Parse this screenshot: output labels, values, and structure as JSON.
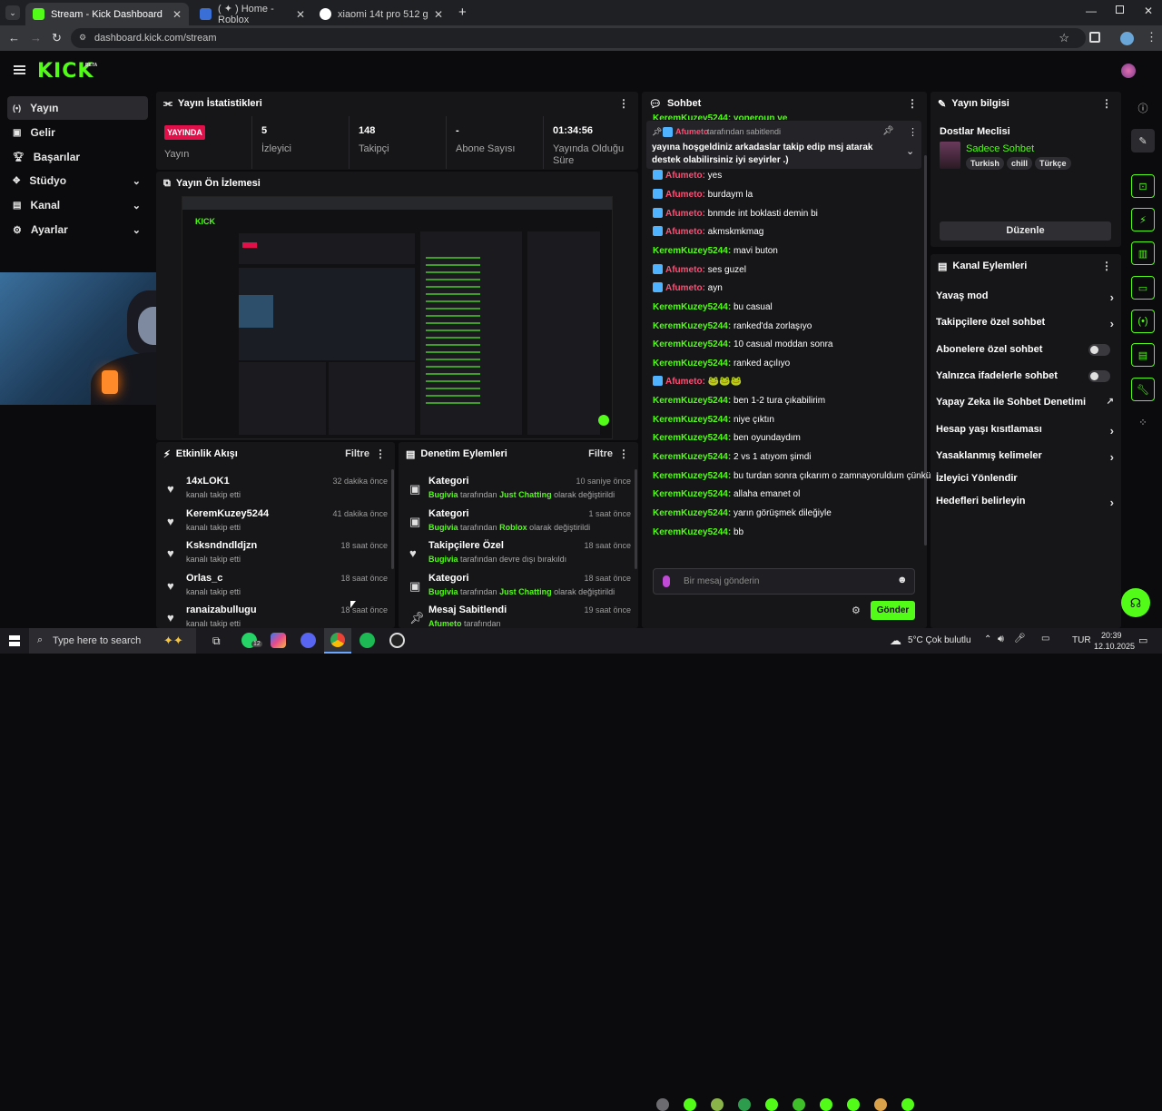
{
  "browser": {
    "tabs": [
      {
        "label": "Stream - Kick Dashboard"
      },
      {
        "label": "( ✦ ) Home - Roblox"
      },
      {
        "label": "xiaomi 14t pro 512 gb - Google"
      }
    ],
    "url": "dashboard.kick.com/stream"
  },
  "kick": {
    "logo": "KICK",
    "beta": "BETA"
  },
  "sidebar": {
    "items": [
      {
        "label": "Yayın"
      },
      {
        "label": "Gelir"
      },
      {
        "label": "Başarılar"
      },
      {
        "label": "Stüdyo"
      },
      {
        "label": "Kanal"
      },
      {
        "label": "Ayarlar"
      }
    ]
  },
  "stats": {
    "title": "Yayın İstatistikleri",
    "live_badge": "YAYINDA",
    "live_label": "Yayın",
    "items": [
      {
        "value": "5",
        "label": "İzleyici"
      },
      {
        "value": "148",
        "label": "Takipçi"
      },
      {
        "value": "-",
        "label": "Abone Sayısı"
      },
      {
        "value": "01:34:56",
        "label": "Yayında Olduğu Süre"
      }
    ]
  },
  "preview": {
    "title": "Yayın Ön İzlemesi"
  },
  "activity": {
    "title": "Etkinlik Akışı",
    "filter": "Filtre",
    "rows": [
      {
        "name": "14xLOK1",
        "sub": "kanalı takip etti",
        "time": "32 dakika önce"
      },
      {
        "name": "KeremKuzey5244",
        "sub": "kanalı takip etti",
        "time": "41 dakika önce"
      },
      {
        "name": "Ksksndndldjzn",
        "sub": "kanalı takip etti",
        "time": "18 saat önce"
      },
      {
        "name": "Orlas_c",
        "sub": "kanalı takip etti",
        "time": "18 saat önce"
      },
      {
        "name": "ranaizabullugu",
        "sub": "kanalı takip etti",
        "time": "18 saat önce"
      }
    ]
  },
  "moderation": {
    "title": "Denetim Eylemleri",
    "filter": "Filtre",
    "rows": [
      {
        "title": "Kategori",
        "user": "Bugivia",
        "mid": "tarafından",
        "hl": "Just Chatting",
        "end": "olarak değiştirildi",
        "time": "10 saniye önce"
      },
      {
        "title": "Kategori",
        "user": "Bugivia",
        "mid": "tarafından",
        "hl": "Roblox",
        "end": "olarak değiştirildi",
        "time": "1 saat önce"
      },
      {
        "title": "Takipçilere Özel",
        "user": "Bugivia",
        "mid": "tarafından devre dışı bırakıldı",
        "hl": "",
        "end": "",
        "time": "18 saat önce"
      },
      {
        "title": "Kategori",
        "user": "Bugivia",
        "mid": "tarafından",
        "hl": "Just Chatting",
        "end": "olarak değiştirildi",
        "time": "18 saat önce"
      },
      {
        "title": "Mesaj Sabitlendi",
        "user": "Afumeto",
        "mid": "tarafından",
        "hl": "",
        "end": "",
        "time": "19 saat önce"
      }
    ]
  },
  "chat": {
    "title": "Sohbet",
    "top_partial": "KeremKuzey5244: yoneroun ve",
    "pinned_by": "Afumeto",
    "pinned_label": "tarafından sabitlendi",
    "pinned_text": "yayına hoşgeldiniz arkadaslar takip edip msj atarak destek olabilirsiniz iyi seyirler .)",
    "messages": [
      {
        "user": "Afumeto",
        "text": "yes",
        "type": "p"
      },
      {
        "user": "Afumeto",
        "text": "burdaym la",
        "type": "p"
      },
      {
        "user": "Afumeto",
        "text": "bnmde int boklasti demin bi",
        "type": "p"
      },
      {
        "user": "Afumeto",
        "text": "akmskmkmag",
        "type": "p"
      },
      {
        "user": "KeremKuzey5244",
        "text": "mavi buton",
        "type": "g"
      },
      {
        "user": "Afumeto",
        "text": "ses guzel",
        "type": "p"
      },
      {
        "user": "Afumeto",
        "text": "ayn",
        "type": "p"
      },
      {
        "user": "KeremKuzey5244",
        "text": "bu casual",
        "type": "g"
      },
      {
        "user": "KeremKuzey5244",
        "text": "ranked'da zorlaşıyo",
        "type": "g"
      },
      {
        "user": "KeremKuzey5244",
        "text": "10 casual moddan sonra",
        "type": "g"
      },
      {
        "user": "KeremKuzey5244",
        "text": "ranked açılıyo",
        "type": "g"
      },
      {
        "user": "Afumeto",
        "text": "🐸🐸🐸",
        "type": "p"
      },
      {
        "user": "KeremKuzey5244",
        "text": "ben 1-2 tura çıkabilirim",
        "type": "g"
      },
      {
        "user": "KeremKuzey5244",
        "text": "niye çıktın",
        "type": "g"
      },
      {
        "user": "KeremKuzey5244",
        "text": "ben oyundaydım",
        "type": "g"
      },
      {
        "user": "KeremKuzey5244",
        "text": "2 vs 1 atıyom şimdi",
        "type": "g"
      },
      {
        "user": "KeremKuzey5244",
        "text": "bu turdan sonra çıkarım o zamnayoruldum çünkü",
        "type": "g"
      },
      {
        "user": "KeremKuzey5244",
        "text": "allaha emanet ol",
        "type": "g"
      },
      {
        "user": "KeremKuzey5244",
        "text": "yarın görüşmek dileğiyle",
        "type": "g"
      },
      {
        "user": "KeremKuzey5244",
        "text": "bb",
        "type": "g"
      }
    ],
    "input_placeholder": "Bir mesaj gönderin",
    "send": "Gönder"
  },
  "info": {
    "title": "Yayın bilgisi",
    "stream_title": "Dostlar Meclisi",
    "mode": "Sadece Sohbet",
    "tags": [
      "Turkish",
      "chill",
      "Türkçe"
    ],
    "edit": "Düzenle"
  },
  "channel_actions": {
    "title": "Kanal Eylemleri",
    "items": [
      {
        "label": "Yavaş mod",
        "ctl": "arrow"
      },
      {
        "label": "Takipçilere özel sohbet",
        "ctl": "arrow"
      },
      {
        "label": "Abonelere özel sohbet",
        "ctl": "toggle"
      },
      {
        "label": "Yalnızca ifadelerle sohbet",
        "ctl": "toggle"
      },
      {
        "label": "Yapay Zeka ile Sohbet Denetimi",
        "ctl": "ext"
      },
      {
        "label": "Hesap yaşı kısıtlaması",
        "ctl": "arrow"
      },
      {
        "label": "Yasaklanmış kelimeler",
        "ctl": "arrow"
      },
      {
        "label": "İzleyici Yönlendir",
        "ctl": "none"
      },
      {
        "label": "Hedefleri belirleyin",
        "ctl": "arrow"
      }
    ]
  },
  "taskbar": {
    "search": "Type here to search",
    "weather": "5°C  Çok bulutlu",
    "lang": "TUR",
    "time": "20:39",
    "date": "12.10.2025",
    "wa_badge": "12"
  },
  "colors": {
    "kick_green": "#53fc18",
    "panel": "#161619",
    "bg": "#0b0b0d",
    "pink": "#ff4d74",
    "live": "#e2104a"
  }
}
